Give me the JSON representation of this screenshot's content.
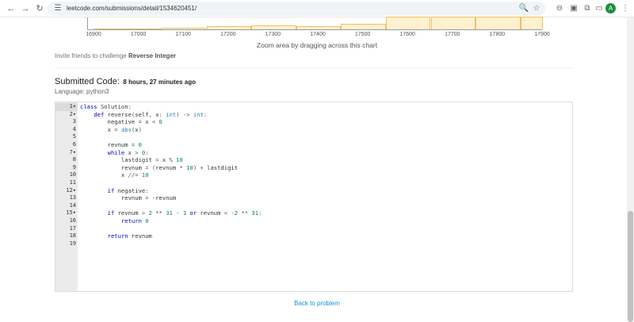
{
  "browser": {
    "back_icon": "arrow-left-icon",
    "forward_icon": "arrow-right-icon",
    "reload_icon": "reload-icon",
    "url": "leetcode.com/submissions/detail/1534620451/",
    "avatar_letter": "A"
  },
  "chart": {
    "hint": "Zoom area by dragging across this chart",
    "ticks": [
      "16900",
      "17000",
      "17100",
      "17200",
      "17300",
      "17400",
      "17500",
      "17600",
      "17700",
      "17800",
      "17900"
    ],
    "bar_color": "#fdf1cf"
  },
  "chart_data": {
    "type": "bar",
    "x": [
      16900,
      17000,
      17100,
      17200,
      17300,
      17400,
      17500,
      17600,
      17700,
      17800,
      17900
    ],
    "xlim": [
      16900,
      17900
    ],
    "bars": [
      {
        "x0": 16900,
        "x1": 17050,
        "value": 0.08
      },
      {
        "x0": 17050,
        "x1": 17150,
        "value": 0.14
      },
      {
        "x0": 17150,
        "x1": 17250,
        "value": 0.22
      },
      {
        "x0": 17250,
        "x1": 17350,
        "value": 0.3
      },
      {
        "x0": 17350,
        "x1": 17450,
        "value": 0.26
      },
      {
        "x0": 17450,
        "x1": 17550,
        "value": 0.45
      },
      {
        "x0": 17550,
        "x1": 17650,
        "value": 1.0
      },
      {
        "x0": 17650,
        "x1": 17750,
        "value": 1.0
      },
      {
        "x0": 17750,
        "x1": 17850,
        "value": 1.0
      },
      {
        "x0": 17850,
        "x1": 17900,
        "value": 1.0
      }
    ]
  },
  "invite": {
    "prefix": "Invite friends to challenge",
    "problem": "Reverse Integer"
  },
  "submission": {
    "heading": "Submitted Code:",
    "time": "8 hours, 27 minutes ago",
    "language": "Language: python3"
  },
  "code": {
    "lines": [
      "class Solution:",
      "    def reverse(self, x: int) -> int:",
      "        negative = x < 0",
      "        x = abs(x)",
      "",
      "        revnum = 0",
      "        while x > 0:",
      "            lastdigit = x % 10",
      "            revnum = (revnum * 10) + lastdigit",
      "            x //= 10",
      "",
      "        if negative:",
      "            revnum = -revnum",
      "",
      "        if revnum > 2 ** 31 - 1 or revnum < -2 ** 31:",
      "            return 0",
      "",
      "        return revnum",
      ""
    ],
    "fold_lines": [
      1,
      2,
      7,
      12,
      15
    ]
  },
  "footer": {
    "back_link": "Back to problem"
  }
}
